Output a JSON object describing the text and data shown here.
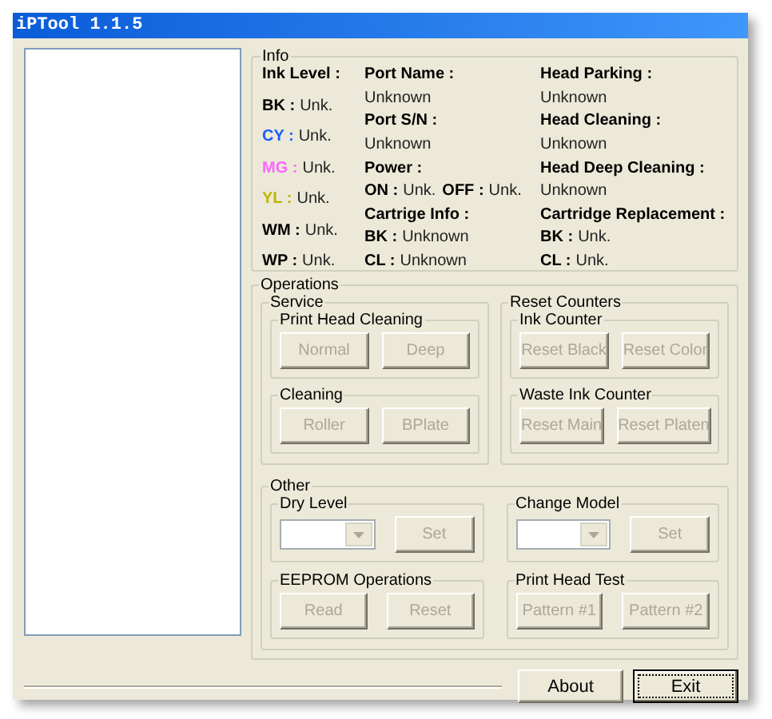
{
  "window": {
    "title": "iPTool 1.1.5"
  },
  "info": {
    "title": "Info",
    "columns": [
      {
        "lines": [
          {
            "kind": "heading",
            "text": "Ink Level :"
          },
          {
            "kind": "pairs",
            "pairs": [
              {
                "label": "BK :",
                "value": "Unk.",
                "color": "#000000"
              }
            ]
          },
          {
            "kind": "pairs",
            "pairs": [
              {
                "label": "CY :",
                "value": "Unk.",
                "color": "#1a5cff"
              }
            ]
          },
          {
            "kind": "pairs",
            "pairs": [
              {
                "label": "MG :",
                "value": "Unk.",
                "color": "#ff66ff"
              }
            ]
          },
          {
            "kind": "pairs",
            "pairs": [
              {
                "label": "YL :",
                "value": "Unk.",
                "color": "#bdb500"
              }
            ]
          },
          {
            "kind": "pairs",
            "pairs": [
              {
                "label": "WM :",
                "value": "Unk.",
                "color": "#000000"
              }
            ]
          },
          {
            "kind": "pairs",
            "pairs": [
              {
                "label": "WP :",
                "value": "Unk.",
                "color": "#000000"
              }
            ]
          }
        ]
      },
      {
        "lines": [
          {
            "kind": "heading",
            "text": "Port Name :"
          },
          {
            "kind": "value",
            "text": "Unknown"
          },
          {
            "kind": "heading",
            "text": "Port S/N :"
          },
          {
            "kind": "value",
            "text": "Unknown"
          },
          {
            "kind": "heading",
            "text": "Power :"
          },
          {
            "kind": "pairs",
            "pairs": [
              {
                "label": "ON :",
                "value": "Unk."
              },
              {
                "label": "OFF :",
                "value": "Unk."
              }
            ]
          },
          {
            "kind": "heading",
            "text": "Cartrige Info :"
          },
          {
            "kind": "pairs",
            "pairs": [
              {
                "label": "BK :",
                "value": "Unknown"
              }
            ]
          },
          {
            "kind": "pairs",
            "pairs": [
              {
                "label": "CL :",
                "value": "Unknown"
              }
            ]
          }
        ]
      },
      {
        "lines": [
          {
            "kind": "heading",
            "text": "Head Parking :"
          },
          {
            "kind": "value",
            "text": "Unknown"
          },
          {
            "kind": "heading",
            "text": "Head Cleaning :"
          },
          {
            "kind": "value",
            "text": "Unknown"
          },
          {
            "kind": "heading",
            "text": "Head Deep Cleaning :"
          },
          {
            "kind": "value",
            "text": "Unknown"
          },
          {
            "kind": "heading",
            "text": "Cartridge Replacement :"
          },
          {
            "kind": "pairs",
            "pairs": [
              {
                "label": "BK :",
                "value": "Unk."
              }
            ]
          },
          {
            "kind": "pairs",
            "pairs": [
              {
                "label": "CL :",
                "value": "Unk."
              }
            ]
          }
        ]
      }
    ]
  },
  "operations": {
    "title": "Operations",
    "sections": [
      {
        "title": "Service",
        "groups": [
          {
            "title": "Print Head Cleaning",
            "controls": [
              {
                "kind": "button",
                "label": "Normal",
                "disabled": true
              },
              {
                "kind": "button",
                "label": "Deep",
                "disabled": true
              }
            ]
          },
          {
            "title": "Cleaning",
            "controls": [
              {
                "kind": "button",
                "label": "Roller",
                "disabled": true
              },
              {
                "kind": "button",
                "label": "BPlate",
                "disabled": true
              }
            ]
          }
        ]
      },
      {
        "title": "Reset Counters",
        "groups": [
          {
            "title": "Ink Counter",
            "controls": [
              {
                "kind": "button",
                "label": "Reset Black",
                "disabled": true
              },
              {
                "kind": "button",
                "label": "Reset Color",
                "disabled": true
              }
            ]
          },
          {
            "title": "Waste Ink Counter",
            "controls": [
              {
                "kind": "button",
                "label": "Reset Main",
                "disabled": true
              },
              {
                "kind": "button",
                "label": "Reset Platen",
                "disabled": true
              }
            ]
          }
        ]
      },
      {
        "title": "Other",
        "groups": [
          {
            "title": "Dry Level",
            "controls": [
              {
                "kind": "combo",
                "disabled": true
              },
              {
                "kind": "button",
                "label": "Set",
                "disabled": true
              }
            ]
          },
          {
            "title": "Change Model",
            "controls": [
              {
                "kind": "combo",
                "disabled": true
              },
              {
                "kind": "button",
                "label": "Set",
                "disabled": true
              }
            ]
          },
          {
            "title": "EEPROM Operations",
            "controls": [
              {
                "kind": "button",
                "label": "Read",
                "disabled": true
              },
              {
                "kind": "button",
                "label": "Reset",
                "disabled": true
              }
            ]
          },
          {
            "title": "Print Head Test",
            "controls": [
              {
                "kind": "button",
                "label": "Pattern #1",
                "disabled": true
              },
              {
                "kind": "button",
                "label": "Pattern #2",
                "disabled": true
              }
            ]
          }
        ]
      }
    ]
  },
  "buttons": [
    {
      "label": "About",
      "default": false
    },
    {
      "label": "Exit",
      "default": true
    }
  ]
}
